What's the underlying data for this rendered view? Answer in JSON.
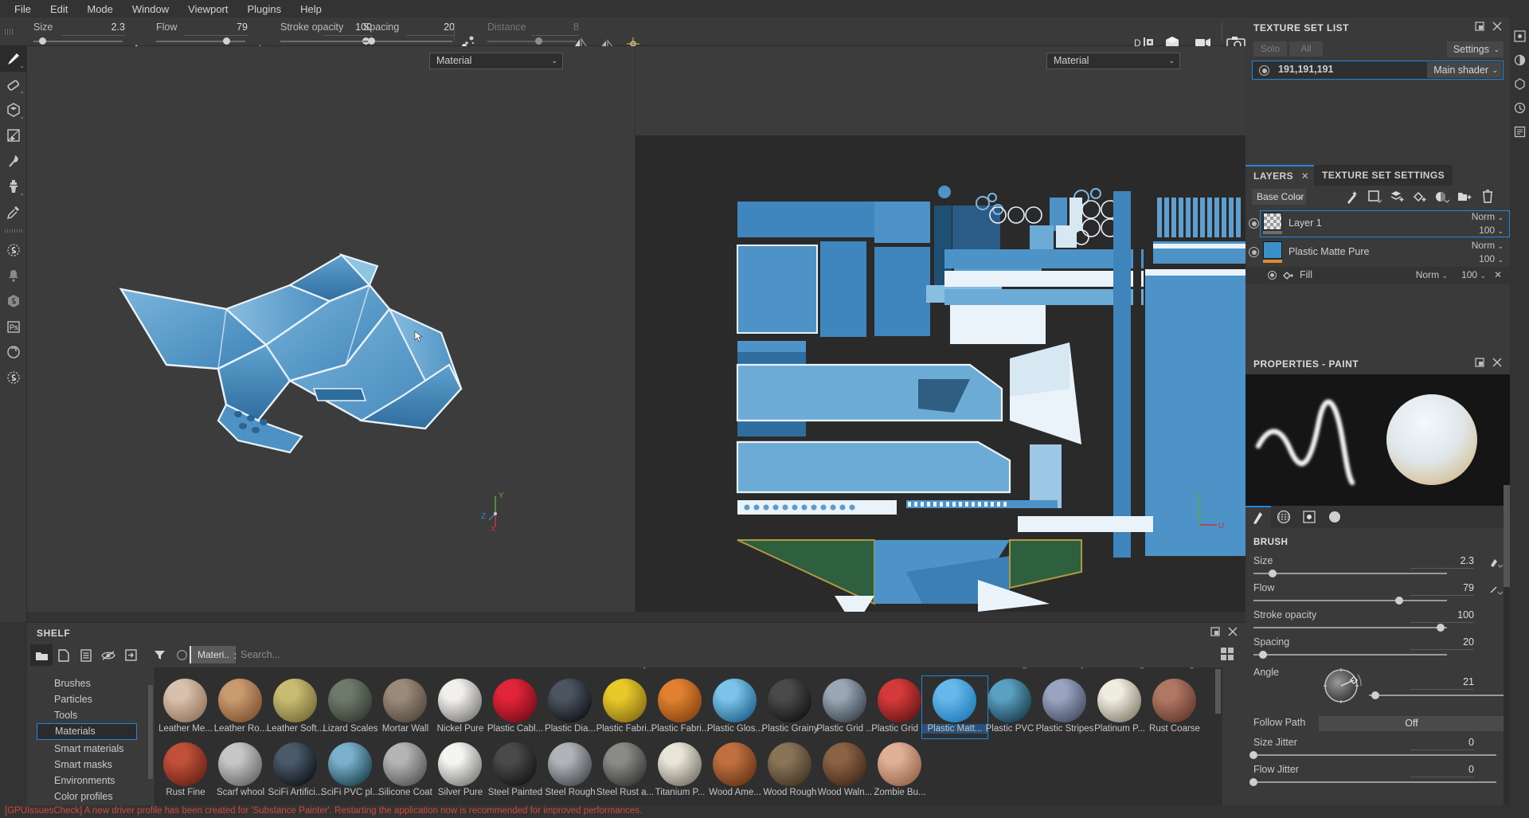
{
  "app": {
    "title": "Substance Painter"
  },
  "menu": {
    "items": [
      "File",
      "Edit",
      "Mode",
      "Window",
      "Viewport",
      "Plugins",
      "Help"
    ]
  },
  "toolbar": {
    "size": {
      "label": "Size",
      "value": "2.3",
      "fill": 0.1
    },
    "flow": {
      "label": "Flow",
      "value": "79",
      "fill": 0.79
    },
    "stroke_opacity": {
      "label": "Stroke opacity",
      "value": "100",
      "fill": 1.0
    },
    "spacing": {
      "label": "Spacing",
      "value": "20",
      "fill": 0.06
    },
    "distance": {
      "label": "Distance",
      "value": "8",
      "fill": 0.55
    },
    "icons": [
      "brush-tip-icon",
      "flow-curve-icon",
      "alpha-icon",
      "particle-icon",
      "mirror-x-icon",
      "mirror-y-icon",
      "symmetry-axis-icon",
      "display-channel-icon",
      "shading-mode-icon",
      "camera-mode-icon",
      "screenshot-icon"
    ]
  },
  "left_rail": {
    "items": [
      {
        "name": "paint-tool",
        "icon": "brush-icon",
        "selected": true,
        "has_chevron": true
      },
      {
        "name": "eraser-tool",
        "icon": "eraser-icon",
        "selected": false,
        "has_chevron": true
      },
      {
        "name": "projection-tool",
        "icon": "cube-icon",
        "selected": false,
        "has_chevron": true
      },
      {
        "name": "polygon-fill-tool",
        "icon": "polygon-fill-icon",
        "selected": false,
        "has_chevron": false
      },
      {
        "name": "smudge-tool",
        "icon": "smudge-icon",
        "selected": false,
        "has_chevron": false
      },
      {
        "name": "clone-tool",
        "icon": "clone-stamp-icon",
        "selected": false,
        "has_chevron": true
      },
      {
        "name": "material-picker-tool",
        "icon": "eyedropper-icon",
        "selected": false,
        "has_chevron": false
      },
      {
        "name": "divider",
        "icon": "divider",
        "selected": false,
        "has_chevron": false
      },
      {
        "name": "substance-engine",
        "icon": "substance-badge-icon",
        "selected": false,
        "has_chevron": false
      },
      {
        "name": "notifications",
        "icon": "bell-icon",
        "selected": false,
        "has_chevron": false
      },
      {
        "name": "substance-source",
        "icon": "substance-hex-icon",
        "selected": false,
        "has_chevron": false
      },
      {
        "name": "photoshop-link",
        "icon": "ps-icon",
        "selected": false,
        "has_chevron": false
      },
      {
        "name": "substance-share",
        "icon": "share-icon",
        "selected": false,
        "has_chevron": false
      },
      {
        "name": "substance-launcher",
        "icon": "launcher-icon",
        "selected": false,
        "has_chevron": false
      }
    ]
  },
  "viewport_3d": {
    "channel_selector": "Material",
    "gizmo_axes": [
      "X",
      "Y",
      "Z"
    ]
  },
  "viewport_2d": {
    "channel_selector": "Material",
    "gizmo_axes": [
      "U",
      "V"
    ]
  },
  "texture_set_list": {
    "title": "TEXTURE SET LIST",
    "solo_label": "Solo",
    "all_label": "All",
    "settings_label": "Settings",
    "sets": [
      {
        "name": "191,191,191",
        "shader": "Main shader",
        "selected": true
      }
    ]
  },
  "layers_panel": {
    "tab_layers": "LAYERS",
    "tab_texture_set_settings": "TEXTURE SET SETTINGS",
    "channel": "Base Color",
    "toolbar_icons": [
      "add-effect-icon",
      "add-adjustment-icon",
      "add-layer-icon",
      "add-fill-layer-icon",
      "add-mask-icon",
      "add-folder-icon",
      "delete-icon"
    ],
    "layers": [
      {
        "name": "Layer 1",
        "blend": "Norm",
        "opacity": "100",
        "selected": true,
        "thumb": "checker",
        "strip": "#6e6e6e"
      },
      {
        "name": "Plastic Matte Pure",
        "blend": "Norm",
        "opacity": "100",
        "selected": false,
        "thumb": "#3a90c8",
        "strip": "#e08a2e"
      }
    ],
    "sublayers": [
      {
        "name": "Fill",
        "blend": "Norm",
        "opacity": "100"
      }
    ]
  },
  "properties_panel": {
    "title": "PROPERTIES - PAINT",
    "tabs": [
      "brush-stroke-tab",
      "alpha-tab",
      "stencil-tab",
      "material-tab"
    ],
    "active_tab_index": 0,
    "section_brush": "BRUSH",
    "params": [
      {
        "label": "Size",
        "value": "2.3",
        "fill": 0.1,
        "has_pen": true
      },
      {
        "label": "Flow",
        "value": "79",
        "fill": 0.77,
        "has_pen": true
      },
      {
        "label": "Stroke opacity",
        "value": "100",
        "fill": 0.98,
        "has_pen": false
      },
      {
        "label": "Spacing",
        "value": "20",
        "fill": 0.06,
        "has_pen": false
      }
    ],
    "angle": {
      "label": "Angle",
      "value": "21",
      "fill": 0.08
    },
    "follow_path": {
      "label": "Follow Path",
      "value": "Off"
    },
    "size_jitter": {
      "label": "Size Jitter",
      "value": "0",
      "fill": 0.0
    },
    "flow_jitter": {
      "label": "Flow Jitter",
      "value": "0",
      "fill": 0.0
    }
  },
  "shelf": {
    "title": "SHELF",
    "toolbar": [
      "folder-icon",
      "new-file-icon",
      "document-icon",
      "hide-icon",
      "import-icon"
    ],
    "filter_icon": "funnel-icon",
    "refresh_icon": "circle-refresh-icon",
    "chip_label": "Materi..",
    "search_placeholder": "Search...",
    "categories": [
      {
        "label": "Brushes",
        "selected": false
      },
      {
        "label": "Particles",
        "selected": false
      },
      {
        "label": "Tools",
        "selected": false
      },
      {
        "label": "Materials",
        "selected": true
      },
      {
        "label": "Smart materials",
        "selected": false
      },
      {
        "label": "Smart masks",
        "selected": false
      },
      {
        "label": "Environments",
        "selected": false
      },
      {
        "label": "Color profiles",
        "selected": false
      }
    ],
    "clipped_row_labels": [
      "Human No...",
      "Human No...",
      "Human Ski...",
      "Human Ski...",
      "Iron Brushed",
      "Iron Chain...",
      "Iron Diamo...",
      "Iron Galvani...",
      "Iron Grainy",
      "Iron Oxided",
      "Iron Hamm...",
      "Iron Powde...",
      "Iron Pure",
      "Iron Rain",
      "Iron Raw D...",
      "Iron Rough",
      "Iron Shiny",
      "Leather Bug",
      "Leather Dig..."
    ],
    "row1": [
      {
        "label": "Leather Me...",
        "c1": "#d8c0ac",
        "c2": "#8a6a52"
      },
      {
        "label": "Leather Ro...",
        "c1": "#c99a6e",
        "c2": "#74482a"
      },
      {
        "label": "Leather Soft...",
        "c1": "#c8bb72",
        "c2": "#6c6230"
      },
      {
        "label": "Lizard Scales",
        "c1": "#6d7a6a",
        "c2": "#2c332b"
      },
      {
        "label": "Mortar Wall",
        "c1": "#9a8a78",
        "c2": "#4a3f36"
      },
      {
        "label": "Nickel Pure",
        "c1": "#f2f0ec",
        "c2": "#6a6a6a"
      },
      {
        "label": "Plastic Cabl...",
        "c1": "#e0243a",
        "c2": "#6c0a14"
      },
      {
        "label": "Plastic Dia...",
        "c1": "#4b5560",
        "c2": "#080a0c"
      },
      {
        "label": "Plastic Fabri...",
        "c1": "#e8c82a",
        "c2": "#7a6410"
      },
      {
        "label": "Plastic Fabri...",
        "c1": "#e08030",
        "c2": "#7a3c0c"
      },
      {
        "label": "Plastic Glos...",
        "c1": "#7cc4ea",
        "c2": "#14547e"
      },
      {
        "label": "Plastic Grainy",
        "c1": "#4a4a4a",
        "c2": "#0c0c0c"
      },
      {
        "label": "Plastic Grid ...",
        "c1": "#9aa6b4",
        "c2": "#2e3640"
      },
      {
        "label": "Plastic Grid ...",
        "c1": "#d43a3a",
        "c2": "#5c1010"
      },
      {
        "label": "Plastic Matt...",
        "c1": "#66b8ea",
        "c2": "#1673b4",
        "selected": true
      },
      {
        "label": "Plastic PVC",
        "c1": "#5aa0c0",
        "c2": "#123040"
      },
      {
        "label": "Plastic Stripes",
        "c1": "#9aa4c0",
        "c2": "#3a4258"
      },
      {
        "label": "Platinum P...",
        "c1": "#efece0",
        "c2": "#7a7260"
      },
      {
        "label": "Rust Coarse",
        "c1": "#b07864",
        "c2": "#5a3024"
      }
    ],
    "row2": [
      {
        "label": "Rust Fine",
        "c1": "#c0503a",
        "c2": "#5c1c10"
      },
      {
        "label": "Scarf whool",
        "c1": "#c6c6c6",
        "c2": "#5a5a5a"
      },
      {
        "label": "SciFi Artifici...",
        "c1": "#4a5a6a",
        "c2": "#060a0e"
      },
      {
        "label": "SciFi PVC pl...",
        "c1": "#7ab0cc",
        "c2": "#12343e"
      },
      {
        "label": "Silicone Coat",
        "c1": "#b4b4b4",
        "c2": "#4a4a4a"
      },
      {
        "label": "Silver Pure",
        "c1": "#f4f4f0",
        "c2": "#6e6e6e"
      },
      {
        "label": "Steel Painted",
        "c1": "#4a4a4a",
        "c2": "#0e0e0e"
      },
      {
        "label": "Steel Rough",
        "c1": "#b0b4b8",
        "c2": "#3a3e42"
      },
      {
        "label": "Steel Rust a...",
        "c1": "#8a8a86",
        "c2": "#2c2c28"
      },
      {
        "label": "Titanium P...",
        "c1": "#e8e4d8",
        "c2": "#6a665a"
      },
      {
        "label": "Wood Ame...",
        "c1": "#c07040",
        "c2": "#5a2c10"
      },
      {
        "label": "Wood Rough",
        "c1": "#8a7458",
        "c2": "#3a2e1c"
      },
      {
        "label": "Wood Waln...",
        "c1": "#8a6244",
        "c2": "#3a2214"
      },
      {
        "label": "Zombie Bu...",
        "c1": "#e0b096",
        "c2": "#8a5a42"
      }
    ]
  },
  "status_bar": {
    "message": "[GPUIssuesCheck] A new driver profile has been created for 'Substance Painter'. Restarting the application now is recommended for improved performances.",
    "color": "#cf4a3c"
  },
  "right_icon_strip": {
    "items": [
      "viewport-settings-icon",
      "display-settings-icon",
      "shader-settings-icon",
      "history-icon",
      "log-icon"
    ]
  }
}
